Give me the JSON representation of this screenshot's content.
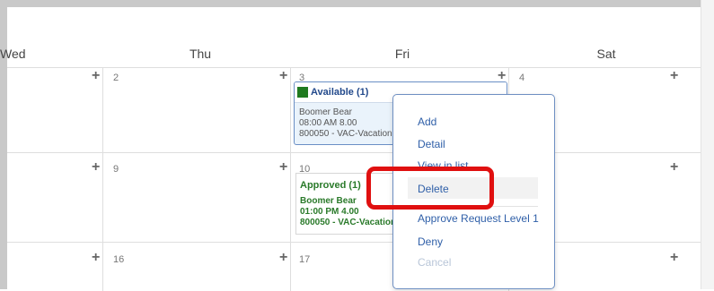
{
  "days": {
    "wed": "Wed",
    "thu": "Thu",
    "fri": "Fri",
    "sat": "Sat"
  },
  "dates": {
    "row1": [
      "2",
      "3",
      "4"
    ],
    "row2": [
      "9",
      "10"
    ],
    "row3": [
      "16",
      "17"
    ]
  },
  "add_glyph": "+",
  "events": {
    "available": {
      "title": "Available (1)",
      "name": "Boomer Bear",
      "time": "08:00 AM 8.00",
      "code": "800050 - VAC-Vacation",
      "swatch_color": "#1f7a1f"
    },
    "approved": {
      "title": "Approved (1)",
      "name": "Boomer Bear",
      "time": "01:00 PM 4.00",
      "code": "800050 - VAC-Vacation",
      "text_color": "#2a7a2a"
    }
  },
  "context_menu": {
    "items": [
      "Add",
      "Detail",
      "View in list",
      "Delete",
      "Approve Request Level 1",
      "Deny",
      "Cancel"
    ],
    "disabled": [
      "Cancel"
    ],
    "hovered": "Delete",
    "highlight_color": "#e01010"
  }
}
